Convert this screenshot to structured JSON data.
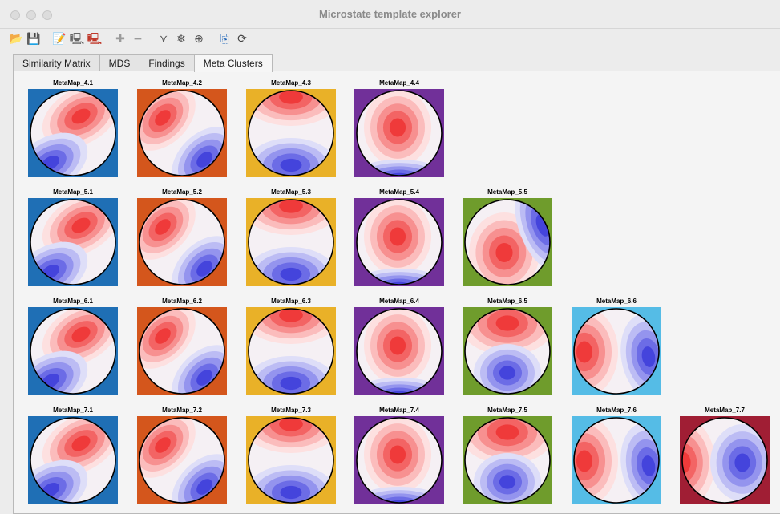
{
  "window": {
    "title": "Microstate template explorer"
  },
  "toolbar": {
    "buttons": [
      {
        "name": "open-folder-icon",
        "glyph": "📂"
      },
      {
        "name": "save-icon",
        "glyph": "💾"
      },
      {
        "name": "edit-icon",
        "glyph": "📝"
      },
      {
        "name": "select-data-icon",
        "glyph": "🖳"
      },
      {
        "name": "delete-data-icon",
        "glyph": "🖳"
      },
      {
        "name": "add-icon",
        "glyph": "✚"
      },
      {
        "name": "remove-icon",
        "glyph": "━"
      },
      {
        "name": "sort-icon",
        "glyph": "⋎"
      },
      {
        "name": "cluster-icon",
        "glyph": "❄"
      },
      {
        "name": "flip-icon",
        "glyph": "⊕"
      },
      {
        "name": "export-icon",
        "glyph": "⎘"
      },
      {
        "name": "refresh-icon",
        "glyph": "⟳"
      }
    ]
  },
  "tabs": [
    {
      "label": "Similarity Matrix",
      "active": false
    },
    {
      "label": "MDS",
      "active": false
    },
    {
      "label": "Findings",
      "active": false
    },
    {
      "label": "Meta Clusters",
      "active": true
    }
  ],
  "colors": {
    "blue": "#1f6fb5",
    "orange": "#d4561c",
    "yellow": "#e9b128",
    "purple": "#713099",
    "green": "#6f9c2c",
    "lightblue": "#55bce6",
    "darkred": "#a01e34"
  },
  "rows": [
    {
      "maps": [
        {
          "label": "MetaMap_4.1",
          "color": "blue",
          "pattern": "tl-red"
        },
        {
          "label": "MetaMap_4.2",
          "color": "orange",
          "pattern": "tl-red-br"
        },
        {
          "label": "MetaMap_4.3",
          "color": "yellow",
          "pattern": "top-red"
        },
        {
          "label": "MetaMap_4.4",
          "color": "purple",
          "pattern": "center-red"
        }
      ]
    },
    {
      "maps": [
        {
          "label": "MetaMap_5.1",
          "color": "blue",
          "pattern": "tl-red"
        },
        {
          "label": "MetaMap_5.2",
          "color": "orange",
          "pattern": "tl-red-br"
        },
        {
          "label": "MetaMap_5.3",
          "color": "yellow",
          "pattern": "top-red"
        },
        {
          "label": "MetaMap_5.4",
          "color": "purple",
          "pattern": "center-red"
        },
        {
          "label": "MetaMap_5.5",
          "color": "green",
          "pattern": "center-strong"
        }
      ]
    },
    {
      "maps": [
        {
          "label": "MetaMap_6.1",
          "color": "blue",
          "pattern": "tl-red"
        },
        {
          "label": "MetaMap_6.2",
          "color": "orange",
          "pattern": "tl-red-br"
        },
        {
          "label": "MetaMap_6.3",
          "color": "yellow",
          "pattern": "top-red"
        },
        {
          "label": "MetaMap_6.4",
          "color": "purple",
          "pattern": "center-red"
        },
        {
          "label": "MetaMap_6.5",
          "color": "green",
          "pattern": "top-red-bottom-blue"
        },
        {
          "label": "MetaMap_6.6",
          "color": "lightblue",
          "pattern": "left-red"
        }
      ]
    },
    {
      "maps": [
        {
          "label": "MetaMap_7.1",
          "color": "blue",
          "pattern": "tl-red"
        },
        {
          "label": "MetaMap_7.2",
          "color": "orange",
          "pattern": "tl-red-br"
        },
        {
          "label": "MetaMap_7.3",
          "color": "yellow",
          "pattern": "top-red"
        },
        {
          "label": "MetaMap_7.4",
          "color": "purple",
          "pattern": "center-red"
        },
        {
          "label": "MetaMap_7.5",
          "color": "green",
          "pattern": "top-red-bottom-blue"
        },
        {
          "label": "MetaMap_7.6",
          "color": "lightblue",
          "pattern": "left-red"
        },
        {
          "label": "MetaMap_7.7",
          "color": "darkred",
          "pattern": "left-red-right-blue"
        }
      ]
    }
  ]
}
